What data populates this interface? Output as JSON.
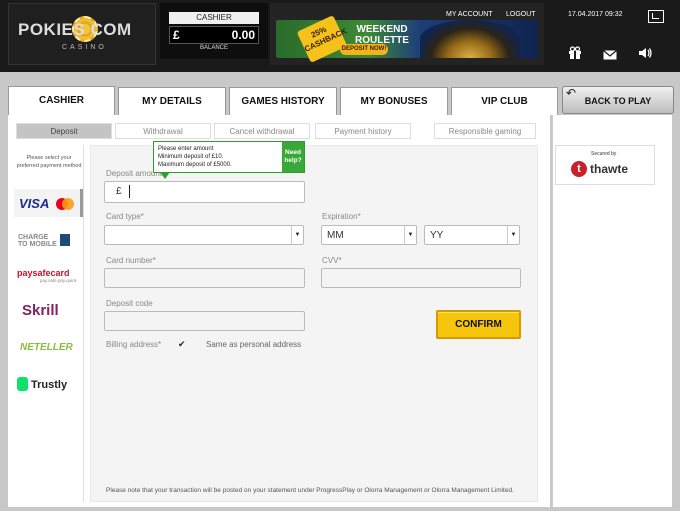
{
  "header": {
    "logo_main": "POKIES COM",
    "logo_sub": "CASINO",
    "cashier_label": "CASHIER",
    "currency_symbol": "£",
    "balance_value": "0.00",
    "balance_label": "BALANCE",
    "banner": {
      "cashback": "25% CASHBACK",
      "title": "WEEKEND ROULETTE",
      "cta": "DEPOSIT NOW!"
    },
    "my_account": "MY ACCOUNT",
    "logout": "LOGOUT",
    "datetime": "17.04.2017 09:32",
    "icons": [
      "screen-icon",
      "gift-icon",
      "mail-icon",
      "sound-icon"
    ]
  },
  "tabs": [
    {
      "label": "CASHIER",
      "active": true
    },
    {
      "label": "MY DETAILS"
    },
    {
      "label": "GAMES HISTORY"
    },
    {
      "label": "MY BONUSES"
    },
    {
      "label": "VIP CLUB"
    }
  ],
  "back_button": "BACK TO PLAY",
  "subtabs": [
    {
      "label": "Deposit",
      "active": true
    },
    {
      "label": "Withdrawal"
    },
    {
      "label": "Cancel withdrawal"
    },
    {
      "label": "Payment history"
    },
    {
      "label": "Responsible gaming"
    }
  ],
  "methods": {
    "note": "Please select your preferred payment method",
    "items": [
      "VISA",
      "CHARGE TO MOBILE",
      "paysafecard",
      "Skrill",
      "NETELLER",
      "Trustly"
    ],
    "paysafe_sub": "pay.safe.pay.quick"
  },
  "tooltip": {
    "line1": "Please enter amount",
    "line2": "Minimum deposit of £10.",
    "line3": "Maximum deposit of £5000.",
    "help": "Need help?"
  },
  "form": {
    "deposit_amount_label": "Deposit amount",
    "amount_currency": "£",
    "card_type_label": "Card type*",
    "expiration_label": "Expiration*",
    "month_value": "MM",
    "year_value": "YY",
    "card_number_label": "Card number*",
    "cvv_label": "CVV*",
    "deposit_code_label": "Deposit code",
    "billing_label": "Billing address*",
    "billing_checkbox_text": "Same as personal address",
    "confirm": "CONFIRM",
    "note": "Please note that your transaction will be posted on your statement under ProgressPlay or Olorra Management or Olorra Management Limited."
  },
  "security": {
    "secured_by": "Secured by",
    "brand": "thawte"
  },
  "colors": {
    "confirm": "#f6c60d",
    "header_bg": "#1a1a1a",
    "help_green": "#39a839"
  }
}
